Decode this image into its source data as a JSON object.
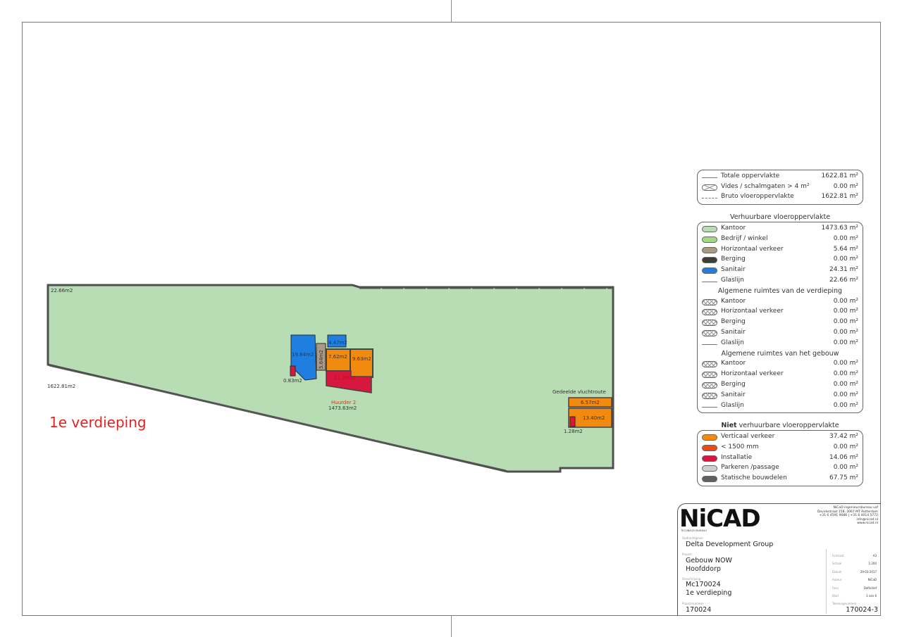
{
  "floor_title": "1e verdieping",
  "plan": {
    "area_labels": {
      "glaslijn_corner": "22.66m2",
      "gross_left": "1622.81m2",
      "sanitair_large": "19.84m2",
      "horizontaal": "5.64m2",
      "sanitair_small": "4.47m2",
      "stair_a": "7.62m2",
      "stair_b": "9.63m2",
      "installatie": "11.35m2",
      "installatie_small": "0.83m2",
      "huurder_name": "Huurder 2",
      "huurder_area": "1473.63m2",
      "route_title": "Gedeelde vluchtroute",
      "route_top": "6.57m2",
      "route_bottom": "13.40m2",
      "route_small": "1.28m2"
    }
  },
  "legend_totals": [
    {
      "label": "Totale oppervlakte",
      "value": "1622.81 m²",
      "swatch": "line"
    },
    {
      "label": "Vides / schalmgaten > 4 m²",
      "value": "0.00 m²",
      "swatch": "void"
    },
    {
      "label": "Bruto vloeroppervlakte",
      "value": "1622.81 m²",
      "swatch": "dash"
    }
  ],
  "legend_rentable": {
    "heading": "Verhuurbare vloeroppervlakte",
    "rows": [
      {
        "label": "Kantoor",
        "value": "1473.63 m²",
        "color": "#b8dcb3",
        "swatch": "fill"
      },
      {
        "label": "Bedrijf / winkel",
        "value": "0.00 m²",
        "color": "#9fdc7e",
        "swatch": "fill"
      },
      {
        "label": "Horizontaal verkeer",
        "value": "5.64 m²",
        "color": "#a89a85",
        "swatch": "fill"
      },
      {
        "label": "Berging",
        "value": "0.00 m²",
        "color": "#3e3e34",
        "swatch": "fill"
      },
      {
        "label": "Sanitair",
        "value": "24.31 m²",
        "color": "#1f7fe0",
        "swatch": "fill"
      },
      {
        "label": "Glaslijn",
        "value": "22.66 m²",
        "swatch": "line"
      }
    ],
    "sub1": "Algemene ruimtes van de verdieping",
    "rows1": [
      {
        "label": "Kantoor",
        "value": "0.00 m²",
        "swatch": "hatch"
      },
      {
        "label": "Horizontaal verkeer",
        "value": "0.00 m²",
        "swatch": "hatch"
      },
      {
        "label": "Berging",
        "value": "0.00 m²",
        "swatch": "hatch"
      },
      {
        "label": "Sanitair",
        "value": "0.00 m²",
        "swatch": "hatch"
      },
      {
        "label": "Glaslijn",
        "value": "0.00 m²",
        "swatch": "line"
      }
    ],
    "sub2": "Algemene ruimtes van het gebouw",
    "rows2": [
      {
        "label": "Kantoor",
        "value": "0.00 m²",
        "swatch": "hatch"
      },
      {
        "label": "Horizontaal verkeer",
        "value": "0.00 m²",
        "swatch": "hatch"
      },
      {
        "label": "Berging",
        "value": "0.00 m²",
        "swatch": "hatch"
      },
      {
        "label": "Sanitair",
        "value": "0.00 m²",
        "swatch": "hatch"
      },
      {
        "label": "Glaslijn",
        "value": "0.00 m²",
        "swatch": "line"
      }
    ]
  },
  "legend_non_rentable": {
    "heading_bold": "Niet",
    "heading_rest": " verhuurbare vloeroppervlakte",
    "rows": [
      {
        "label": "Verticaal verkeer",
        "value": "37.42 m²",
        "color": "#f28a10",
        "swatch": "fill"
      },
      {
        "label": "< 1500 mm",
        "value": "0.00 m²",
        "color": "#f04a10",
        "swatch": "fill"
      },
      {
        "label": "Installatie",
        "value": "14.06 m²",
        "color": "#d8173f",
        "swatch": "fill"
      },
      {
        "label": "Parkeren /passage",
        "value": "0.00 m²",
        "color": "#cfcfcf",
        "swatch": "fill"
      },
      {
        "label": "Statische bouwdelen",
        "value": "67.75 m²",
        "color": "#606060",
        "swatch": "fill"
      }
    ]
  },
  "title_block": {
    "logo_text": "NiCAD",
    "logo_sub": "T E C H N I S C H   B U R E A U",
    "company_lines": [
      "NiCaD ingenieursbureau vof",
      "Davidsstraat 158, 3067 MT Rotterdam",
      "+31 6 4591 9086 | +31 6 4014 5772",
      "info@nicad.nl",
      "www.nicad.nl"
    ],
    "opdrachtgever_label": "Opdrachtgever",
    "opdrachtgever": "Delta Development Group",
    "project_label": "Project",
    "project_line1": "Gebouw NOW",
    "project_line2": "Hoofddorp",
    "tekening_label": "Omschrijving",
    "tekening_line1": "Mc170024",
    "tekening_line2": "1e verdieping",
    "projectnummer_label": "Projectnummer",
    "projectnummer": "170024",
    "fields": [
      {
        "label": "Formaat",
        "value": "A3"
      },
      {
        "label": "Schaal",
        "value": "1:200"
      },
      {
        "label": "Datum",
        "value": "29-03-2017"
      },
      {
        "label": "Auteur",
        "value": "NiCaD"
      },
      {
        "label": "Fase",
        "value": "Definitief"
      },
      {
        "label": "Blad",
        "value": "3 van 6"
      }
    ],
    "tekeningnummer_label": "Tekeningnummer",
    "tekeningnummer": "170024-3"
  }
}
